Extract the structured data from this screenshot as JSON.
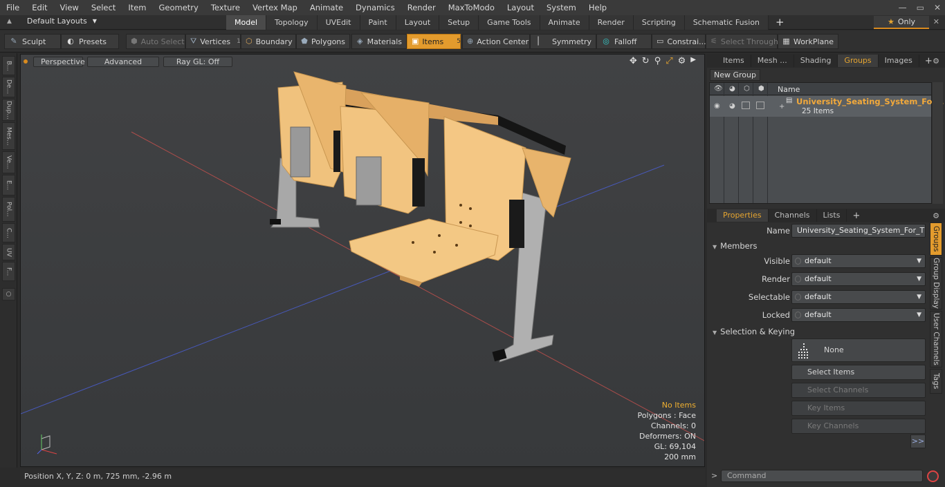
{
  "menu": [
    "File",
    "Edit",
    "View",
    "Select",
    "Item",
    "Geometry",
    "Texture",
    "Vertex Map",
    "Animate",
    "Dynamics",
    "Render",
    "MaxToModo",
    "Layout",
    "System",
    "Help"
  ],
  "window_controls": [
    "—",
    "▭",
    "✕"
  ],
  "layout": {
    "selector": "Default Layouts",
    "tabs": [
      "Model",
      "Topology",
      "UVEdit",
      "Paint",
      "Layout",
      "Setup",
      "Game Tools",
      "Animate",
      "Render",
      "Scripting",
      "Schematic Fusion"
    ],
    "active_tab": "Model",
    "only_label": "Only"
  },
  "toolbar": {
    "sculpt": "Sculpt",
    "presets": "Presets",
    "auto_select": "Auto Select",
    "vertices": "Vertices",
    "vertices_count": "1",
    "boundary": "Boundary",
    "polygons": "Polygons",
    "materials": "Materials",
    "items": "Items",
    "items_count": "5",
    "action_center": "Action Center",
    "symmetry": "Symmetry",
    "falloff": "Falloff",
    "constraints": "Constrai...",
    "select_through": "Select Through",
    "workplane": "WorkPlane"
  },
  "left_strip": [
    "B...",
    "De...",
    "Dup...",
    "Mes...",
    "Ve...",
    "E...",
    "Pol...",
    "C...",
    "UV",
    "F..."
  ],
  "viewport": {
    "view": "Perspective",
    "shading": "Advanced",
    "raygl": "Ray GL: Off",
    "info": {
      "no_items": "No Items",
      "polygons": "Polygons : Face",
      "channels": "Channels: 0",
      "deformers": "Deformers: ON",
      "gl": "GL: 69,104",
      "scale": "200 mm"
    }
  },
  "status": "Position X, Y, Z:   0 m, 725 mm, -2.96 m",
  "items_panel": {
    "tabs": [
      "Items",
      "Mesh ...",
      "Shading",
      "Groups",
      "Images"
    ],
    "active_tab": "Groups",
    "new_group": "New Group",
    "name_header": "Name",
    "group_name": "University_Seating_System_For...",
    "group_count": "25 Items"
  },
  "properties": {
    "tabs": [
      "Properties",
      "Channels",
      "Lists"
    ],
    "active_tab": "Properties",
    "name_label": "Name",
    "name_value": "University_Seating_System_For_Thre",
    "members_section": "Members",
    "visible_label": "Visible",
    "visible_value": "default",
    "render_label": "Render",
    "render_value": "default",
    "selectable_label": "Selectable",
    "selectable_value": "default",
    "locked_label": "Locked",
    "locked_value": "default",
    "selection_section": "Selection & Keying",
    "none_btn": "None",
    "select_items": "Select Items",
    "select_channels": "Select Channels",
    "key_items": "Key Items",
    "key_channels": "Key Channels",
    "more": ">>",
    "side_tabs": [
      "Groups",
      "Group Display",
      "User Channels",
      "Tags"
    ]
  },
  "command": {
    "placeholder": "Command"
  },
  "colors": {
    "accent": "#e39b2d",
    "group_name": "#f2a93b",
    "warn": "#f0b030"
  }
}
